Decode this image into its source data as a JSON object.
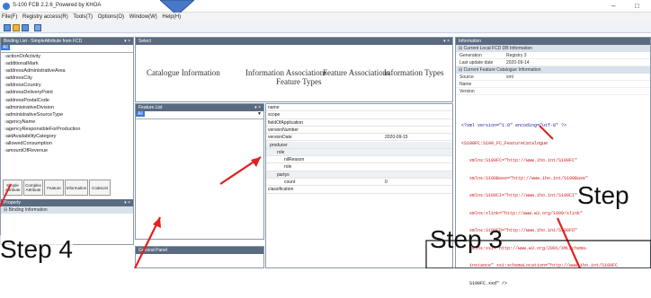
{
  "window": {
    "title": "S-100 FCB 2.2.6_Powered by KHOA",
    "minimize": "–",
    "maximize": "□"
  },
  "menu": [
    "File(F)",
    "Registry access(R)",
    "Tools(T)",
    "Options(O)",
    "Window(W)",
    "Help(H)"
  ],
  "binding_list": {
    "header": "Binding List - SimpleAttribute from FCD",
    "filter_value": "All",
    "items": [
      "actionOrActivity",
      "additionalMark",
      "addressAdministrativeArea",
      "addressCity",
      "addressCountry",
      "addressDeliveryPoint",
      "addressPostalCode",
      "administrativeDivision",
      "administrativeSourceType",
      "agencyName",
      "agencyResponsibleForProduction",
      "aidAvailabilityCategory",
      "allowedConsumption",
      "amountOfRevenue"
    ],
    "tabs": [
      "Simple Attribute",
      "Complex Attribute",
      "Feature",
      "Information",
      "CodeList"
    ]
  },
  "property": {
    "header": "Property",
    "section": "Binding Information"
  },
  "select": {
    "header": "Select",
    "tabs": [
      "Catalogue Information",
      "Information Associations",
      "Feature Associations",
      "Information Types",
      "Feature Types"
    ]
  },
  "feature_list": {
    "header": "Feature List",
    "filter_value": "All"
  },
  "generic_panel": {
    "header": "General Panel"
  },
  "grid": {
    "rows": [
      {
        "k": "name",
        "v": ""
      },
      {
        "k": "scope",
        "v": ""
      },
      {
        "k": "fieldOfApplication",
        "v": ""
      },
      {
        "k": "versionNumber",
        "v": ""
      },
      {
        "k": "versionDate",
        "v": "2020-09-15"
      },
      {
        "k": "producer",
        "v": ""
      },
      {
        "k": "role",
        "v": ""
      },
      {
        "k": "nilReason",
        "v": ""
      },
      {
        "k": "role",
        "v": ""
      },
      {
        "k": "partys",
        "v": ""
      },
      {
        "k": "count",
        "v": "0"
      },
      {
        "k": "classification",
        "v": ""
      }
    ]
  },
  "information": {
    "header": "Information",
    "sec1": "Current Local FCD DB Information",
    "rows1": [
      {
        "k": "Generation",
        "v": "Registry 3"
      },
      {
        "k": "Last update date",
        "v": "2020-09-14"
      }
    ],
    "sec2": "Current Feature Catalogue Information",
    "rows2": [
      {
        "k": "Source",
        "v": "xml"
      },
      {
        "k": "Name",
        "v": ""
      },
      {
        "k": "Version",
        "v": ""
      }
    ]
  },
  "xml_lines": [
    "<?xml version=\"1.0\" encoding=\"utf-8\" ?>",
    "<S100FC:S100_FC_FeatureCatalogue",
    "   xmlns:S100FC=\"http://www.iho.int/S100FC\"",
    "   xmlns:S100Base=\"http://www.iho.int/S100Base\"",
    "   xmlns:S100CI=\"http://www.iho.int/S100CI\"",
    "   xmlns:xlink=\"http://www.w3.org/1999/xlink\"",
    "   xmlns:S100FD=\"http://www.iho.int/S100FD\"",
    "   xmlns:xsi=\"http://www.w3.org/2001/XMLSchema-",
    "   instance\" xsi:schemaLocation=\"http://www.iho.int/S100FC",
    "   S100FC.xsd\" />"
  ],
  "annotations": {
    "step3": "Step 3",
    "step4": "Step 4",
    "step_right": "Step"
  }
}
